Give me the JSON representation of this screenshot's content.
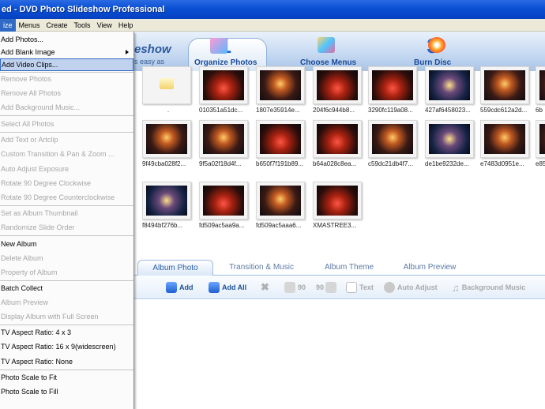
{
  "window": {
    "title": "ed - DVD Photo Slideshow Professional"
  },
  "menubar": {
    "items": [
      "ize",
      "Menus",
      "Create",
      "Tools",
      "View",
      "Help"
    ]
  },
  "dropdown": {
    "items": [
      {
        "label": "Add Photos...",
        "enabled": true
      },
      {
        "label": "Add Blank Image",
        "enabled": true,
        "submenu": true
      },
      {
        "label": "Add Video Clips...",
        "enabled": true,
        "highlighted": true
      },
      {
        "label": "Remove Photos",
        "enabled": false
      },
      {
        "label": "Remove All Photos",
        "enabled": false
      },
      {
        "label": "Add Background Music...",
        "enabled": false
      },
      {
        "label": "Select All Photos",
        "enabled": false
      },
      {
        "label": "Add Text or Artclip",
        "enabled": false
      },
      {
        "label": "Custom Transition & Pan & Zoom ...",
        "enabled": false
      },
      {
        "label": "Auto Adjust Exposure",
        "enabled": false
      },
      {
        "label": "Rotate 90 Degree Clockwise",
        "enabled": false
      },
      {
        "label": "Rotate 90 Degree Counterclockwise",
        "enabled": false
      },
      {
        "label": "Set as Album Thumbnail",
        "enabled": false
      },
      {
        "label": "Randomize Slide Order",
        "enabled": false
      },
      {
        "label": "New Album",
        "enabled": true
      },
      {
        "label": "Delete Album",
        "enabled": false
      },
      {
        "label": "Property of Album",
        "enabled": false
      },
      {
        "label": "Batch Collect",
        "enabled": true
      },
      {
        "label": "Album Preview",
        "enabled": false
      },
      {
        "label": "Display Album with Full Screen",
        "enabled": false
      },
      {
        "label": "TV Aspect Ratio:  4 x 3",
        "enabled": true
      },
      {
        "label": "TV Aspect Ratio: 16 x 9(widescreen)",
        "enabled": true
      },
      {
        "label": "TV Aspect Ratio: None",
        "enabled": true
      },
      {
        "label": "Photo Scale to Fit",
        "enabled": true
      },
      {
        "label": "Photo Scale to Fill",
        "enabled": true
      }
    ]
  },
  "header": {
    "brand": "eshow",
    "tagline": "s easy as",
    "steps": [
      {
        "num": "1",
        "label": "Organize Photos"
      },
      {
        "num": "2",
        "label": "Choose Menus"
      },
      {
        "num": "3",
        "label": "Burn Disc"
      }
    ]
  },
  "grid": {
    "row1": [
      ".",
      "010351a51dc...",
      "1807e35914e...",
      "204f6c944b8...",
      "3290fc119a08...",
      "427af6458023...",
      "559cdc612a2d...",
      "6b"
    ],
    "row2": [
      "9f49cba028f2...",
      "9f5a02f18d4f...",
      "b650f7f191b89...",
      "b64a028c8ea...",
      "c59dc21db4f7...",
      "de1be9232de...",
      "e7483d0951e...",
      "e85"
    ],
    "row3": [
      "f8494bf276b...",
      "fd509ac5aa9a...",
      "fd509ac5aaa6...",
      "XMASTREE3..."
    ]
  },
  "tabs": [
    "Album Photo",
    "Transition & Music",
    "Album Theme",
    "Album Preview"
  ],
  "toolbar": {
    "add": "Add",
    "add_all": "Add All",
    "rotate_cw": "90",
    "rotate_ccw": "90",
    "text": "Text",
    "auto_adjust": "Auto Adjust",
    "background_music": "Background Music"
  }
}
